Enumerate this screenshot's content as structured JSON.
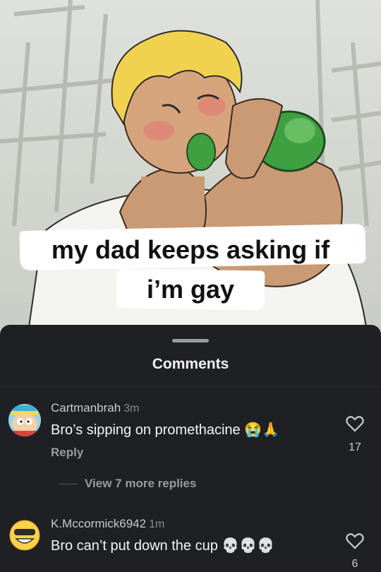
{
  "meme": {
    "caption_line1": "my dad keeps asking if",
    "caption_line2": "i’m gay"
  },
  "comments_panel": {
    "title": "Comments",
    "comments": [
      {
        "username": "Cartmanbrah",
        "time": "3m",
        "text": "Bro’s sipping on promethacine 😭🙏",
        "reply_label": "Reply",
        "likes": "17",
        "avatar_icon": "cartoon-avatar-icon",
        "view_more_label": "View 7 more replies"
      },
      {
        "username": "K.Mccormick6942",
        "time": "1m",
        "text": "Bro can’t put down the cup 💀💀💀",
        "likes": "6",
        "avatar_icon": "smiley-avatar-icon"
      }
    ]
  },
  "colors": {
    "sheet_bg": "#1f2023",
    "hair": "#f0d24f",
    "bottle": "#3fa042",
    "skin": "#c99a73"
  }
}
